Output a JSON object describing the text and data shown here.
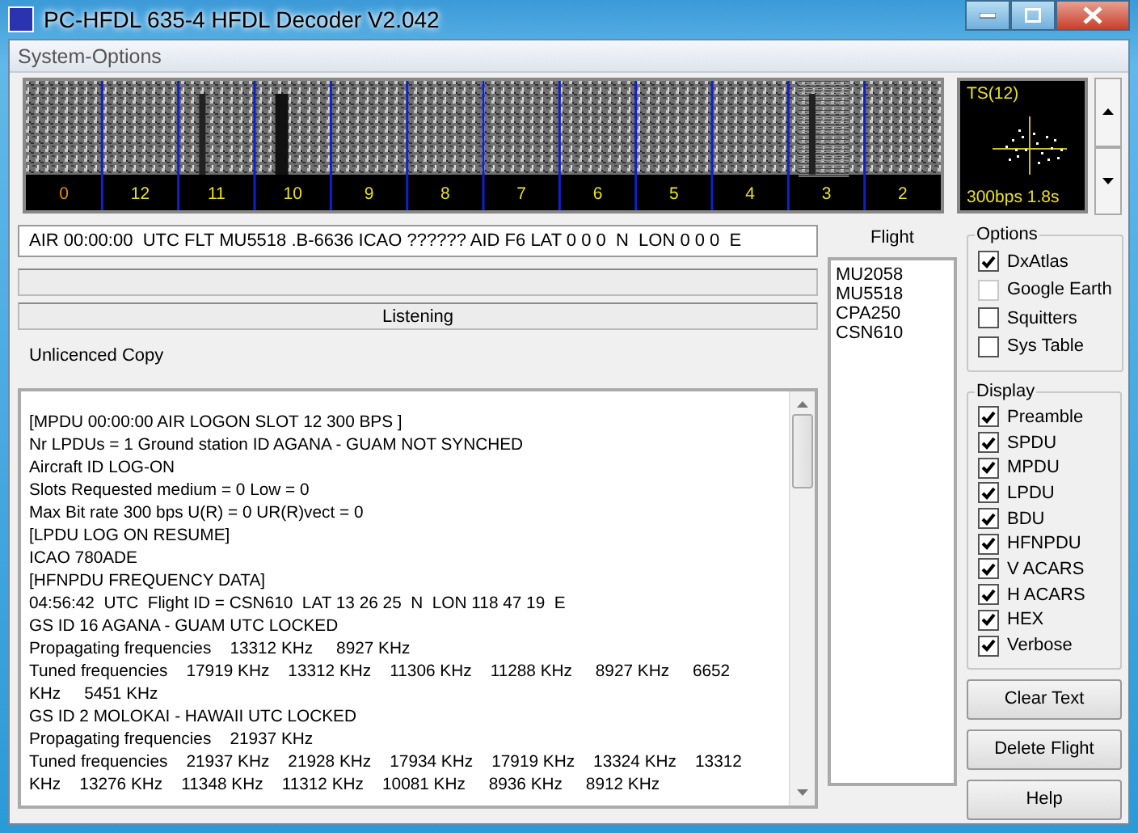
{
  "window": {
    "title": "PC-HFDL 635-4 HFDL Decoder V2.042"
  },
  "menu": [
    "System-Options"
  ],
  "spectrogram": {
    "slots": [
      {
        "label": "0",
        "color": "#e08a00"
      },
      {
        "label": "12",
        "color": "#e8e020"
      },
      {
        "label": "11",
        "color": "#e8e020"
      },
      {
        "label": "10",
        "color": "#e8e020"
      },
      {
        "label": "9",
        "color": "#e8e020"
      },
      {
        "label": "8",
        "color": "#e8e020"
      },
      {
        "label": "7",
        "color": "#e8e020"
      },
      {
        "label": "6",
        "color": "#e8e020"
      },
      {
        "label": "5",
        "color": "#e8e020"
      },
      {
        "label": "4",
        "color": "#e8e020"
      },
      {
        "label": "3",
        "color": "#e8e020"
      },
      {
        "label": "2",
        "color": "#e8e020"
      }
    ]
  },
  "scope": {
    "title": "TS(12)",
    "footer": "300bps 1.8s"
  },
  "message_line": "AIR 00:00:00  UTC FLT MU5518 .B-6636 ICAO ?????? AID F6 LAT 0 0 0  N  LON 0 0 0  E",
  "status": "Listening",
  "licence": "Unlicenced Copy",
  "log": [
    "[MPDU 00:00:00 AIR LOGON SLOT 12 300 BPS ]",
    "Nr LPDUs = 1 Ground station ID AGANA - GUAM NOT SYNCHED",
    "Aircraft ID LOG-ON",
    "Slots Requested medium = 0 Low = 0",
    "Max Bit rate 300 bps U(R) = 0 UR(R)vect = 0",
    "[LPDU LOG ON RESUME]",
    "ICAO 780ADE",
    "[HFNPDU FREQUENCY DATA]",
    "04:56:42  UTC  Flight ID = CSN610  LAT 13 26 25  N  LON 118 47 19  E",
    "GS ID 16 AGANA - GUAM UTC LOCKED",
    "Propagating frequencies    13312 KHz     8927 KHz",
    "Tuned frequencies    17919 KHz    13312 KHz    11306 KHz    11288 KHz     8927 KHz     6652",
    "KHz     5451 KHz",
    "GS ID 2 MOLOKAI - HAWAII UTC LOCKED",
    "Propagating frequencies    21937 KHz",
    "Tuned frequencies    21937 KHz    21928 KHz    17934 KHz    17919 KHz    13324 KHz    13312",
    "KHz    13276 KHz    11348 KHz    11312 KHz    10081 KHz     8936 KHz     8912 KHz"
  ],
  "flights": {
    "heading": "Flight",
    "items": [
      "MU2058",
      "MU5518",
      "CPA250",
      "CSN610"
    ]
  },
  "options": {
    "title": "Options",
    "items": [
      {
        "label": "DxAtlas",
        "checked": true,
        "disabled": false
      },
      {
        "label": "Google Earth",
        "checked": false,
        "disabled": true
      },
      {
        "label": "Squitters",
        "checked": false,
        "disabled": false
      },
      {
        "label": "Sys Table",
        "checked": false,
        "disabled": false
      }
    ]
  },
  "display": {
    "title": "Display",
    "items": [
      {
        "label": "Preamble",
        "checked": true
      },
      {
        "label": "SPDU",
        "checked": true
      },
      {
        "label": "MPDU",
        "checked": true
      },
      {
        "label": "LPDU",
        "checked": true
      },
      {
        "label": "BDU",
        "checked": true
      },
      {
        "label": "HFNPDU",
        "checked": true
      },
      {
        "label": "V ACARS",
        "checked": true
      },
      {
        "label": "H ACARS",
        "checked": true
      },
      {
        "label": "HEX",
        "checked": true
      },
      {
        "label": "Verbose",
        "checked": true
      }
    ]
  },
  "buttons": [
    "Clear Text",
    "Delete Flight",
    "Help"
  ]
}
